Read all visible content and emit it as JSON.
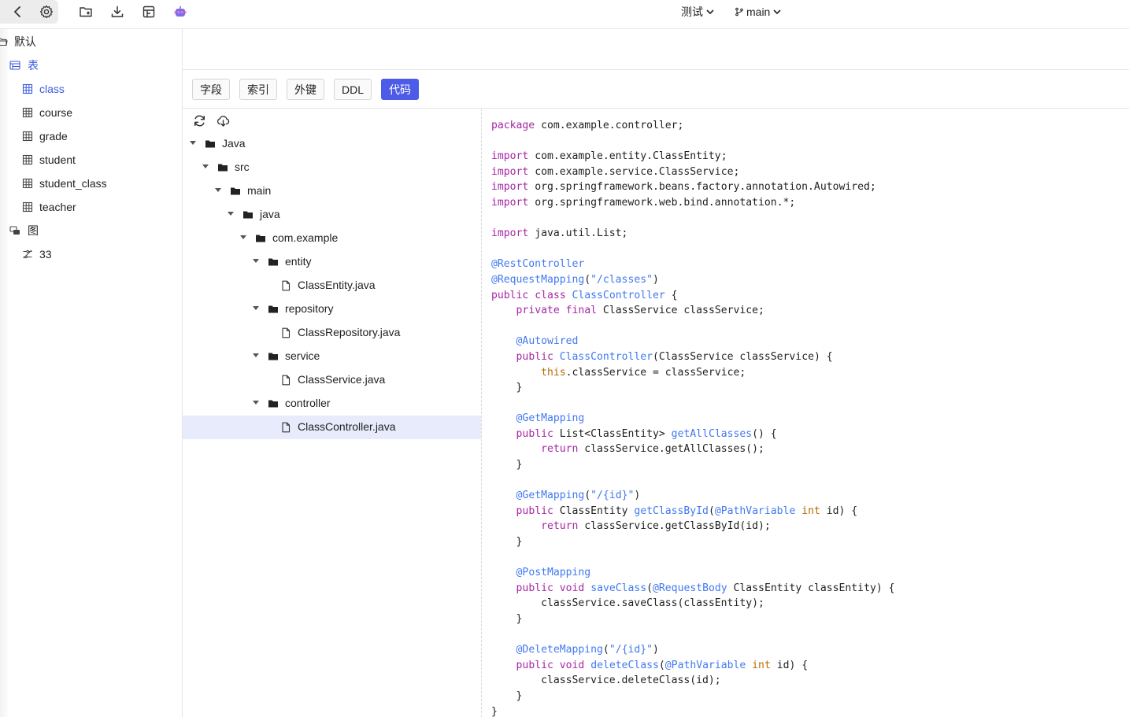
{
  "toolbar": {
    "icons": [
      "back-icon",
      "settings-icon",
      "new-folder-icon",
      "download-icon",
      "table-layout-icon",
      "robot-icon"
    ],
    "database_select": "测试",
    "branch_select": "main"
  },
  "sidebar": {
    "root_label": "默认",
    "tables_group": "表",
    "tables": [
      "class",
      "course",
      "grade",
      "student",
      "student_class",
      "teacher"
    ],
    "active_table": "class",
    "diagrams_group": "图",
    "diagrams": [
      "33"
    ]
  },
  "tabs": [
    {
      "label": "字段",
      "active": false
    },
    {
      "label": "索引",
      "active": false
    },
    {
      "label": "外键",
      "active": false
    },
    {
      "label": "DDL",
      "active": false
    },
    {
      "label": "代码",
      "active": true
    }
  ],
  "file_tree": {
    "tools": [
      "refresh-icon",
      "cloud-download-icon"
    ],
    "nodes": [
      {
        "label": "Java",
        "type": "folder",
        "depth": 0
      },
      {
        "label": "src",
        "type": "folder",
        "depth": 1
      },
      {
        "label": "main",
        "type": "folder",
        "depth": 2
      },
      {
        "label": "java",
        "type": "folder",
        "depth": 3
      },
      {
        "label": "com.example",
        "type": "folder",
        "depth": 4
      },
      {
        "label": "entity",
        "type": "folder",
        "depth": 5
      },
      {
        "label": "ClassEntity.java",
        "type": "file",
        "depth": 6
      },
      {
        "label": "repository",
        "type": "folder",
        "depth": 5
      },
      {
        "label": "ClassRepository.java",
        "type": "file",
        "depth": 6
      },
      {
        "label": "service",
        "type": "folder",
        "depth": 5
      },
      {
        "label": "ClassService.java",
        "type": "file",
        "depth": 6
      },
      {
        "label": "controller",
        "type": "folder",
        "depth": 5
      },
      {
        "label": "ClassController.java",
        "type": "file",
        "depth": 6,
        "selected": true
      }
    ]
  },
  "code": {
    "language": "java",
    "text": "package com.example.controller;\n\nimport com.example.entity.ClassEntity;\nimport com.example.service.ClassService;\nimport org.springframework.beans.factory.annotation.Autowired;\nimport org.springframework.web.bind.annotation.*;\n\nimport java.util.List;\n\n@RestController\n@RequestMapping(\"/classes\")\npublic class ClassController {\n    private final ClassService classService;\n\n    @Autowired\n    public ClassController(ClassService classService) {\n        this.classService = classService;\n    }\n\n    @GetMapping\n    public List<ClassEntity> getAllClasses() {\n        return classService.getAllClasses();\n    }\n\n    @GetMapping(\"/{id}\")\n    public ClassEntity getClassById(@PathVariable int id) {\n        return classService.getClassById(id);\n    }\n\n    @PostMapping\n    public void saveClass(@RequestBody ClassEntity classEntity) {\n        classService.saveClass(classEntity);\n    }\n\n    @DeleteMapping(\"/{id}\")\n    public void deleteClass(@PathVariable int id) {\n        classService.deleteClass(id);\n    }\n}"
  },
  "colors": {
    "accent": "#4c5be8",
    "selected_row": "#e8ebfb",
    "keyword": "#a626a4",
    "annotation": "#4078f2",
    "type": "#b76b01"
  }
}
